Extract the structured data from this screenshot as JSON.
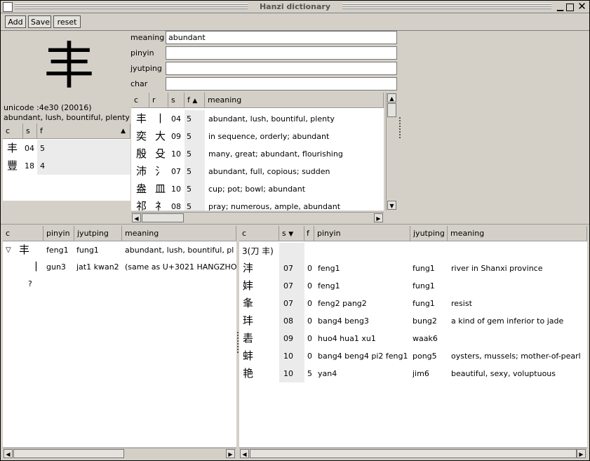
{
  "window": {
    "title": "Hanzi dictionary"
  },
  "toolbar": {
    "add": "Add",
    "save": "Save",
    "reset": "reset"
  },
  "char_info": {
    "character": "丰",
    "unicode": "unicode :4e30 (20016)",
    "definition": "abundant, lush, bountiful, plenty"
  },
  "form": {
    "meaning_label": "meaning",
    "meaning_value": "abundant",
    "pinyin_label": "pinyin",
    "pinyin_value": "",
    "jyutping_label": "jyutping",
    "jyutping_value": "",
    "char_label": "char",
    "char_value": ""
  },
  "left_table": {
    "headers": [
      "c",
      "s",
      "f"
    ],
    "sort_indicator": "▲",
    "rows": [
      {
        "c": "丰",
        "s": "04",
        "f": "5"
      },
      {
        "c": "豐",
        "s": "18",
        "f": "4"
      }
    ]
  },
  "search_table": {
    "headers": [
      "c",
      "r",
      "s",
      "f",
      "meaning"
    ],
    "sort_indicator": "▲",
    "rows": [
      {
        "c": "丰",
        "r": "丨",
        "s": "04",
        "f": "5",
        "meaning": "abundant, lush, bountiful, plenty"
      },
      {
        "c": "奕",
        "r": "大",
        "s": "09",
        "f": "5",
        "meaning": "in sequence, orderly; abundant"
      },
      {
        "c": "殷",
        "r": "殳",
        "s": "10",
        "f": "5",
        "meaning": "many, great; abundant, flourishing"
      },
      {
        "c": "沛",
        "r": "氵",
        "s": "07",
        "f": "5",
        "meaning": "abundant, full, copious; sudden"
      },
      {
        "c": "盎",
        "r": "皿",
        "s": "10",
        "f": "5",
        "meaning": "cup; pot; bowl; abundant"
      },
      {
        "c": "祁",
        "r": "礻",
        "s": "08",
        "f": "5",
        "meaning": "pray; numerous, ample, abundant"
      }
    ]
  },
  "tree_table": {
    "headers": [
      "c",
      "pinyin",
      "jyutping",
      "meaning"
    ],
    "expander": "▽",
    "rows": [
      {
        "c": "丰",
        "pinyin": "feng1",
        "jyutping": "fung1",
        "meaning": "abundant, lush, bountiful, pl"
      },
      {
        "c": "丨",
        "pinyin": "gun3",
        "jyutping": "jat1 kwan2",
        "meaning": "(same as U+3021 HANGZHO"
      },
      {
        "c": "?",
        "pinyin": "",
        "jyutping": "",
        "meaning": ""
      }
    ]
  },
  "component_table": {
    "headers": [
      "c",
      "s",
      "f",
      "pinyin",
      "jyutping",
      "meaning"
    ],
    "sort_indicator": "▼",
    "group": "3(刀 丰)",
    "rows": [
      {
        "c": "沣",
        "s": "07",
        "f": "0",
        "pinyin": "feng1",
        "jyutping": "fung1",
        "meaning": "river in Shanxi province"
      },
      {
        "c": "妦",
        "s": "07",
        "f": "0",
        "pinyin": "feng1",
        "jyutping": "fung1",
        "meaning": ""
      },
      {
        "c": "夆",
        "s": "07",
        "f": "0",
        "pinyin": "feng2 pang2",
        "jyutping": "fung1",
        "meaning": "resist"
      },
      {
        "c": "玤",
        "s": "08",
        "f": "0",
        "pinyin": "bang4 beng3",
        "jyutping": "bung2",
        "meaning": "a kind of gem inferior to jade"
      },
      {
        "c": "砉",
        "s": "09",
        "f": "0",
        "pinyin": "huo4 hua1 xu1",
        "jyutping": "waak6",
        "meaning": ""
      },
      {
        "c": "蚌",
        "s": "10",
        "f": "0",
        "pinyin": "bang4 beng4 pi2 feng1",
        "jyutping": "pong5",
        "meaning": "oysters, mussels; mother-of-pearl"
      },
      {
        "c": "艳",
        "s": "10",
        "f": "5",
        "pinyin": "yan4",
        "jyutping": "jim6",
        "meaning": "beautiful, sexy, voluptuous"
      }
    ]
  },
  "icons": {
    "close": "×",
    "minimize": "_",
    "maximize": "□"
  }
}
